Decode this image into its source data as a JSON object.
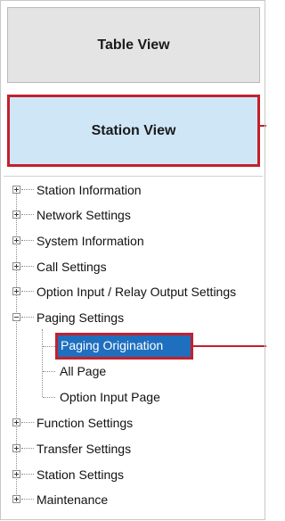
{
  "buttons": {
    "table_view": "Table View",
    "station_view": "Station View"
  },
  "tree": {
    "station_information": "Station Information",
    "network_settings": "Network Settings",
    "system_information": "System Information",
    "call_settings": "Call Settings",
    "option_input_relay": "Option Input / Relay Output Settings",
    "paging_settings": "Paging Settings",
    "paging_children": {
      "paging_origination": "Paging Origination",
      "all_page": "All Page",
      "option_input_page": "Option Input Page"
    },
    "function_settings": "Function Settings",
    "transfer_settings": "Transfer Settings",
    "station_settings": "Station Settings",
    "maintenance": "Maintenance"
  },
  "colors": {
    "highlight_border": "#c3202d",
    "selected_bg": "#1f6fbf",
    "station_view_bg": "#cfe6f7",
    "table_view_bg": "#e4e4e4"
  }
}
